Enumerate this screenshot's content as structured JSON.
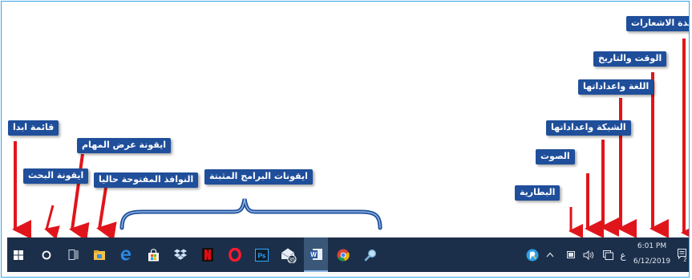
{
  "labels": {
    "notifications": "نافذة الاشعارات",
    "time_date": "الوقت والتاريخ",
    "language": "اللغة واعداداتها",
    "network": "الشبكة واعداداتها",
    "sound": "الصوت",
    "battery": "البطارية",
    "start_menu": "قائمة ابدا",
    "search_icon": "ايقونة البحث",
    "task_view": "ايقونة عرض المهام",
    "open_windows": "النوافذ المفتوحة حاليا",
    "pinned_programs": "ايقونات البرامج المثبتة"
  },
  "taskbar": {
    "pinned_icons": [
      "file-explorer-icon",
      "edge-icon",
      "store-icon",
      "dropbox-icon",
      "netflix-icon",
      "opera-icon",
      "photoshop-icon",
      "mail-icon",
      "word-icon",
      "chrome-icon",
      "search-tool-icon"
    ],
    "mail_badge": "35",
    "photoshop_label": "Ps",
    "word_label": "W",
    "language_indicator": "ع",
    "time": "6:01 PM",
    "date": "6/12/2019",
    "notification_count": "2"
  },
  "colors": {
    "label_bg": "#1f4e9a",
    "arrow": "#e0151b",
    "taskbar_bg": "#1c2f4a",
    "brace": "#1f4e9a",
    "frame_border": "#3aa6e8"
  }
}
